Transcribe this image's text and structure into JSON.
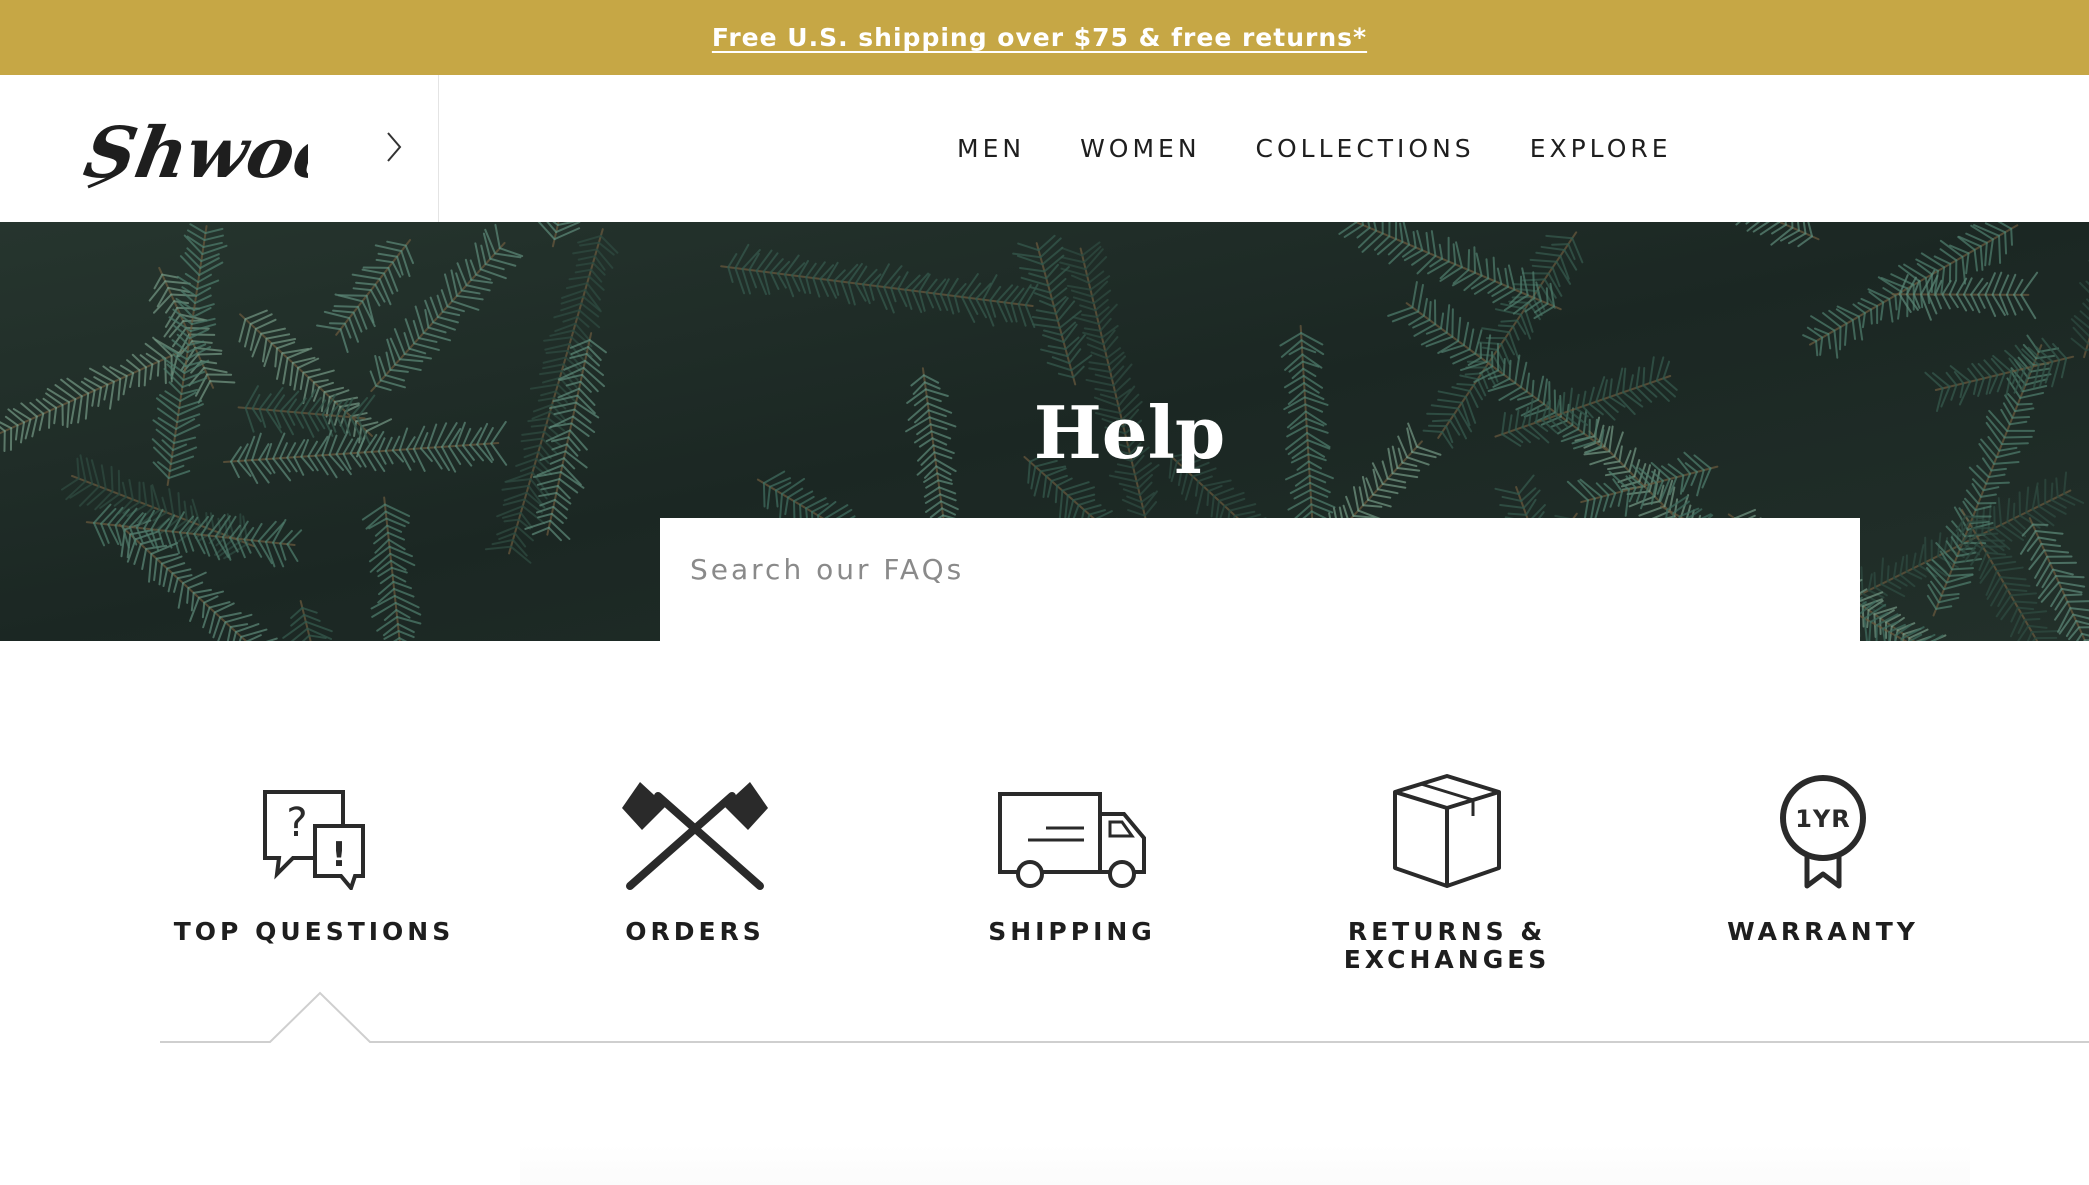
{
  "promo": {
    "text": "Free U.S. shipping over $75 & free returns*"
  },
  "header": {
    "logo_text": "Shwood",
    "logo_icon": "shwood-script-logo",
    "expand_icon": "chevron-right-icon",
    "nav": [
      {
        "label": "MEN"
      },
      {
        "label": "WOMEN"
      },
      {
        "label": "COLLECTIONS"
      },
      {
        "label": "EXPLORE"
      }
    ]
  },
  "hero": {
    "title": "Help",
    "background": "pine-branches-photo",
    "search_placeholder": "Search our FAQs"
  },
  "categories": [
    {
      "label": "TOP QUESTIONS",
      "icon": "speech-bubbles-question-icon",
      "selected": true
    },
    {
      "label": "ORDERS",
      "icon": "crossed-axes-icon",
      "selected": false
    },
    {
      "label": "SHIPPING",
      "icon": "delivery-truck-icon",
      "selected": false
    },
    {
      "label": "RETURNS & EXCHANGES",
      "icon": "box-icon",
      "selected": false
    },
    {
      "label": "WARRANTY",
      "icon": "warranty-badge-icon",
      "badge_text": "1YR",
      "selected": false
    }
  ],
  "colors": {
    "promo_bg": "#c6a745",
    "text_dark": "#1e1e1e",
    "hero_dark": "#1a2420",
    "pine_green": "#3f6b5e"
  }
}
